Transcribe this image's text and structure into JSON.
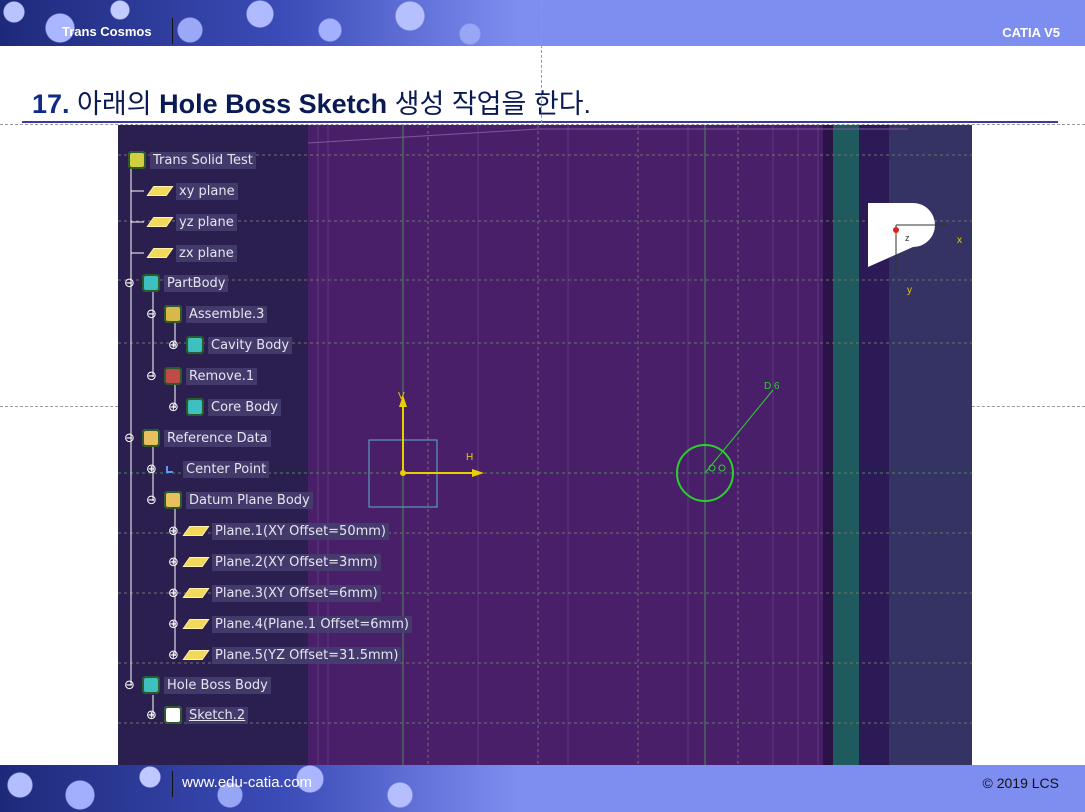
{
  "header": {
    "brand": "Trans Cosmos",
    "version": "CATIA V5"
  },
  "title": {
    "number": "17.",
    "pre": " 아래의 ",
    "bold": "Hole Boss Sketch",
    "post": " 생성 작업을 한다."
  },
  "tree": {
    "nodes": [
      {
        "label": "Trans Solid Test",
        "icon": "product-root-icon"
      },
      {
        "label": "xy plane",
        "icon": "plane-icon"
      },
      {
        "label": "yz plane",
        "icon": "plane-icon"
      },
      {
        "label": "zx plane",
        "icon": "plane-icon"
      },
      {
        "label": "PartBody",
        "icon": "body-icon"
      },
      {
        "label": "Assemble.3",
        "icon": "assemble-icon"
      },
      {
        "label": "Cavity Body",
        "icon": "body-icon"
      },
      {
        "label": "Remove.1",
        "icon": "remove-icon"
      },
      {
        "label": "Core Body",
        "icon": "body-icon"
      },
      {
        "label": "Reference Data",
        "icon": "geometrical-set-icon"
      },
      {
        "label": "Center Point",
        "icon": "point-icon"
      },
      {
        "label": "Datum Plane Body",
        "icon": "geometrical-set-icon"
      },
      {
        "label": "Plane.1(XY Offset=50mm)",
        "icon": "plane-icon"
      },
      {
        "label": "Plane.2(XY Offset=3mm)",
        "icon": "plane-icon"
      },
      {
        "label": "Plane.3(XY Offset=6mm)",
        "icon": "plane-icon"
      },
      {
        "label": "Plane.4(Plane.1 Offset=6mm)",
        "icon": "plane-icon"
      },
      {
        "label": "Plane.5(YZ Offset=31.5mm)",
        "icon": "plane-icon"
      },
      {
        "label": "Hole Boss Body",
        "icon": "body-icon"
      },
      {
        "label": "Sketch.2",
        "icon": "sketch-icon"
      }
    ]
  },
  "canvas": {
    "axis_h_label": "H",
    "axis_v_label": "V",
    "dimension_label": "D 6",
    "compass_z": "z",
    "compass_x": "x",
    "compass_y": "y"
  },
  "colors": {
    "viewport": "#3f1d5e",
    "sketch_circle": "#2ad02a",
    "axis": "#e8d000",
    "teal_band": "#1e5a5e"
  },
  "footer": {
    "url": "www.edu-catia.com",
    "copyright": "© 2019 LCS"
  }
}
